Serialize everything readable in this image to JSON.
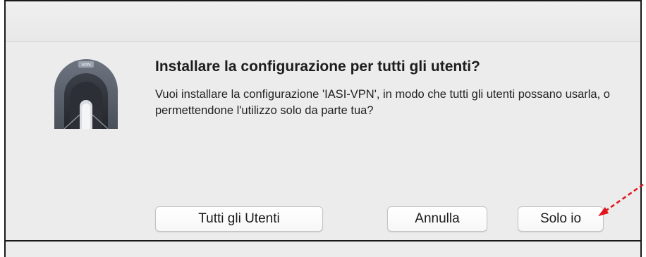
{
  "dialog": {
    "title": "Installare la configurazione per tutti gli utenti?",
    "message": "Vuoi installare la configurazione 'IASI-VPN', in modo che tutti gli utenti possano usarla, o permettendone l'utilizzo solo da parte tua?",
    "icon": {
      "name": "vpn-tunnel-icon",
      "badge_text": "VPN"
    },
    "buttons": {
      "all_users": "Tutti gli Utenti",
      "cancel": "Annulla",
      "only_me": "Solo io"
    }
  },
  "annotation": {
    "arrow_color": "#e0151b",
    "target": "only_me"
  },
  "colors": {
    "dialog_background": "#ececec",
    "icon_gray": "#5d6470",
    "frame_border": "#1a1a1a"
  }
}
